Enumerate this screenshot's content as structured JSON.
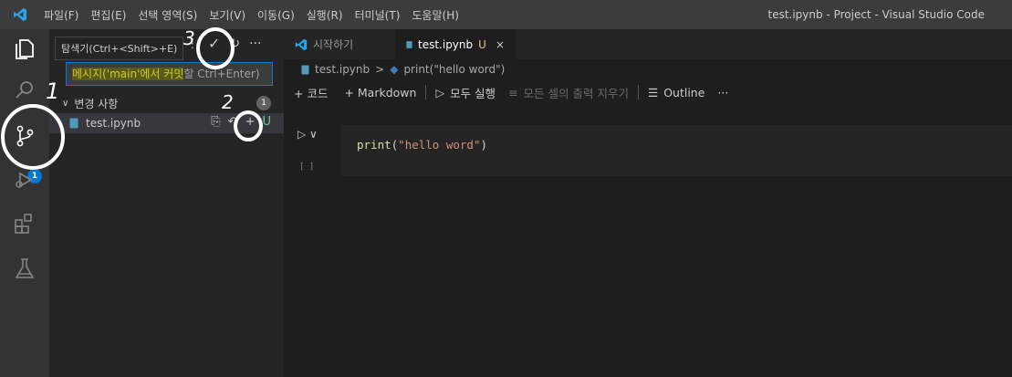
{
  "menu": [
    "파일(F)",
    "편집(E)",
    "선택 영역(S)",
    "보기(V)",
    "이동(G)",
    "실행(R)",
    "터미널(T)",
    "도움말(H)"
  ],
  "window_title": "test.ipynb - Project - Visual Studio Code",
  "sidebar": {
    "tooltip": "탐색기(Ctrl+<Shift>+E)",
    "commit_placeholder_a": "메시지('main'에서 커밋",
    "commit_placeholder_b": "할 Ctrl+Enter)",
    "changes_label": "변경 사항",
    "changes_count": "1",
    "file_name": "test.ipynb",
    "file_status": "U"
  },
  "activity_badge": "1",
  "tabs": [
    {
      "label": "시작하기"
    },
    {
      "label": "test.ipynb",
      "status": "U"
    }
  ],
  "breadcrumb": {
    "file": "test.ipynb",
    "sep": ">",
    "symbol": "print(\"hello word\")"
  },
  "toolbar": {
    "add_code": "+ 코드",
    "add_markdown": "+ Markdown",
    "run_all": "모두 실행",
    "clear_outputs": "모든 셀의 출력 지우기",
    "outline": "Outline",
    "more": "···"
  },
  "cell": {
    "func": "print",
    "open": "(",
    "string": "\"hello word\"",
    "close": ")",
    "exec_count": "[ ]"
  },
  "annotations": [
    "1",
    "2",
    "3"
  ],
  "colors": {
    "accent": "#007fd4",
    "badge": "#0078d4",
    "titlebar": "#3c3c3c"
  }
}
